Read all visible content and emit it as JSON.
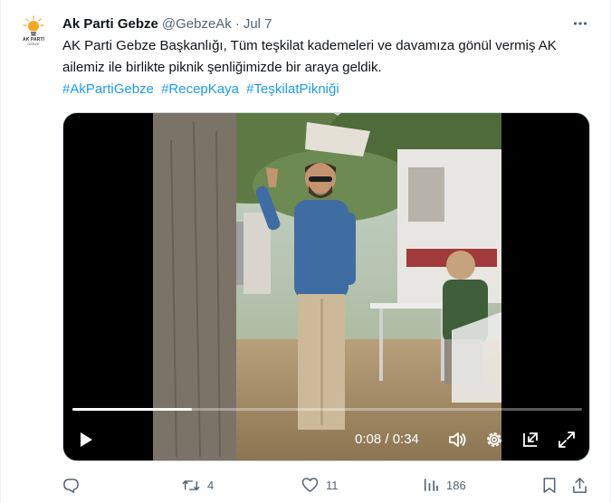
{
  "tweet": {
    "display_name": "Ak Parti Gebze",
    "handle": "@GebzeAk",
    "separator": "·",
    "date": "Jul 7",
    "avatar": {
      "line1": "AK PARTİ",
      "line2": "GEBZE"
    },
    "text": "AK Parti Gebze Başkanlığı, Tüm teşkilat kademeleri ve davamıza gönül vermiş AK ailemiz ile birlikte piknik şenliğimizde bir araya geldik.",
    "hashtags": [
      "#AkPartiGebze",
      "#RecepKaya",
      "#TeşkilatPikniği"
    ]
  },
  "video": {
    "current_time": "0:08",
    "duration": "0:34",
    "time_display": "0:08 / 0:34",
    "progress": 0.235
  },
  "actions": {
    "reply": {
      "icon": "reply-icon",
      "count": ""
    },
    "retweet": {
      "icon": "retweet-icon",
      "count": "4"
    },
    "like": {
      "icon": "heart-icon",
      "count": "11"
    },
    "views": {
      "icon": "views-icon",
      "count": "186"
    },
    "bookmark": {
      "icon": "bookmark-icon"
    },
    "share": {
      "icon": "share-icon"
    }
  },
  "colors": {
    "accent": "#1d9bf0",
    "secondary_text": "#536471",
    "primary_text": "#0f1419",
    "brand_yellow": "#f5a623"
  }
}
